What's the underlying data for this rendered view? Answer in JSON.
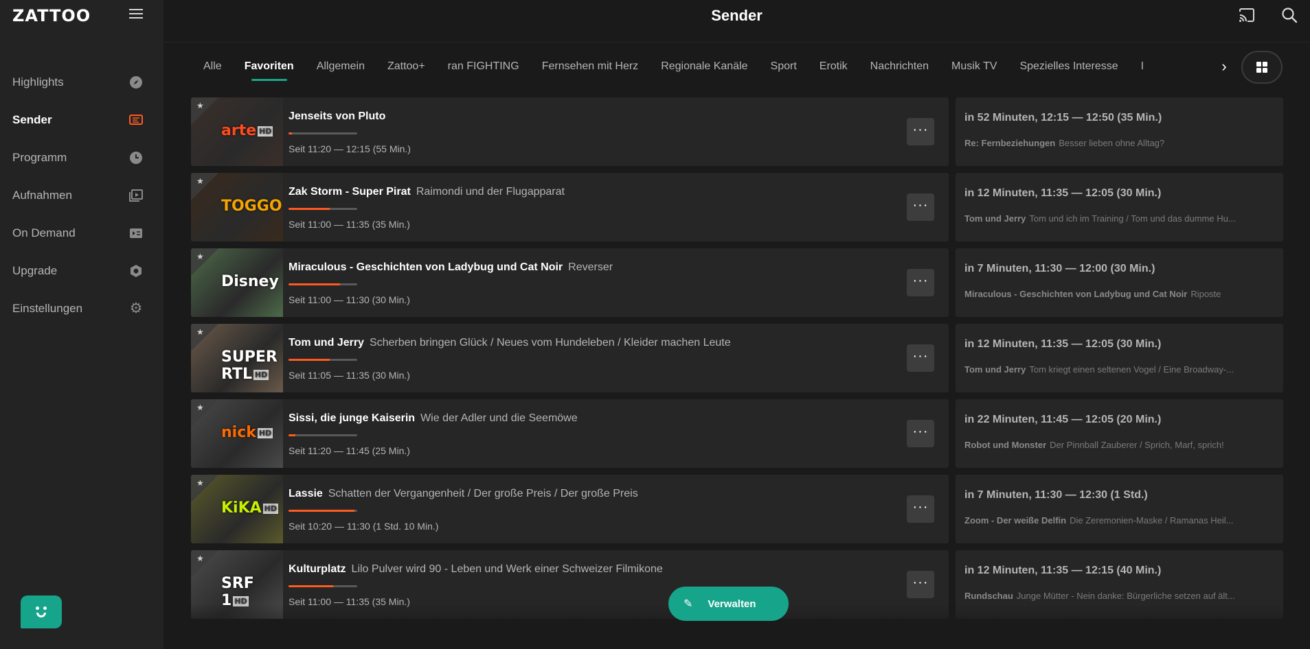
{
  "app": {
    "logo": "ZATTOO"
  },
  "header": {
    "title": "Sender"
  },
  "sidebar": {
    "items": [
      {
        "label": "Highlights",
        "icon": "compass-icon"
      },
      {
        "label": "Sender",
        "icon": "tv-icon",
        "active": true
      },
      {
        "label": "Programm",
        "icon": "clock-icon"
      },
      {
        "label": "Aufnahmen",
        "icon": "recordings-icon"
      },
      {
        "label": "On Demand",
        "icon": "on-demand-icon"
      },
      {
        "label": "Upgrade",
        "icon": "upgrade-icon"
      },
      {
        "label": "Einstellungen",
        "icon": "gear-icon"
      }
    ]
  },
  "tabs": [
    "Alle",
    "Favoriten",
    "Allgemein",
    "Zattoo+",
    "ran FIGHTING",
    "Fernsehen mit Herz",
    "Regionale Kanäle",
    "Sport",
    "Erotik",
    "Nachrichten",
    "Musik TV",
    "Spezielles Interesse",
    "I"
  ],
  "active_tab": "Favoriten",
  "channels": [
    {
      "logo": "arte",
      "logo_hd": "HD",
      "logo_color": "#ff4b1f",
      "title": "Jenseits von Pluto",
      "episode": "",
      "time": "Seit 11:20 — 12:15 (55 Min.)",
      "progress": 0.05,
      "next_head": "in 52 Minuten, 12:15 — 12:50 (35 Min.)",
      "next_title": "Re: Fernbeziehungen",
      "next_episode": "Besser lieben ohne Alltag?",
      "thumb_color": "#3b2f29"
    },
    {
      "logo": "TOGGO",
      "logo_hd": "HD",
      "logo_color": "#f6a400",
      "title": "Zak Storm - Super Pirat",
      "episode": "Raimondi und der Flugapparat",
      "time": "Seit 11:00 — 11:35 (35 Min.)",
      "progress": 0.6,
      "next_head": "in 12 Minuten, 11:35 — 12:05 (30 Min.)",
      "next_title": "Tom und Jerry",
      "next_episode": "Tom und ich im Training / Tom und das dumme Hu...",
      "thumb_color": "#3a2a1c"
    },
    {
      "logo": "Disney",
      "logo_hd": "",
      "logo_color": "#ffffff",
      "title": "Miraculous - Geschichten von Ladybug und Cat Noir",
      "episode": "Reverser",
      "time": "Seit 11:00 — 11:30 (30 Min.)",
      "progress": 0.75,
      "next_head": "in 7 Minuten, 11:30 — 12:00 (30 Min.)",
      "next_title": "Miraculous - Geschichten von Ladybug und Cat Noir",
      "next_episode": "Riposte",
      "thumb_color": "#4d6b4a"
    },
    {
      "logo": "SUPER RTL",
      "logo_hd": "HD",
      "logo_color": "#ffffff",
      "title": "Tom und Jerry",
      "episode": "Scherben bringen Glück / Neues vom Hundeleben / Kleider machen Leute",
      "time": "Seit 11:05 — 11:35 (30 Min.)",
      "progress": 0.6,
      "next_head": "in 12 Minuten, 11:35 — 12:05 (30 Min.)",
      "next_title": "Tom und Jerry",
      "next_episode": "Tom kriegt einen seltenen Vogel / Eine Broadway-...",
      "thumb_color": "#6b5a4a"
    },
    {
      "logo": "nick",
      "logo_hd": "HD",
      "logo_color": "#ff6a00",
      "title": "Sissi, die junge Kaiserin",
      "episode": "Wie der Adler und die Seemöwe",
      "time": "Seit 11:20 — 11:45 (25 Min.)",
      "progress": 0.1,
      "next_head": "in 22 Minuten, 11:45 — 12:05 (20 Min.)",
      "next_title": "Robot und Monster",
      "next_episode": "Der Pinnball Zauberer / Sprich, Marf, sprich!",
      "thumb_color": "#4a4a4a"
    },
    {
      "logo": "KiKA",
      "logo_hd": "HD",
      "logo_color": "#c6f000",
      "title": "Lassie",
      "episode": "Schatten der Vergangenheit / Der große Preis / Der große Preis",
      "time": "Seit 10:20 — 11:30 (1 Std. 10 Min.)",
      "progress": 0.96,
      "next_head": "in 7 Minuten, 11:30 — 12:30 (1 Std.)",
      "next_title": "Zoom - Der weiße Delfin",
      "next_episode": "Die Zeremonien-Maske / Ramanas Heil...",
      "thumb_color": "#5b5a2a"
    },
    {
      "logo": "SRF 1",
      "logo_hd": "HD",
      "logo_color": "#ffffff",
      "title": "Kulturplatz",
      "episode": "Lilo Pulver wird 90 - Leben und Werk einer Schweizer Filmikone",
      "time": "Seit 11:00 — 11:35 (35 Min.)",
      "progress": 0.65,
      "next_head": "in 12 Minuten, 11:35 — 12:15 (40 Min.)",
      "next_title": "Rundschau",
      "next_episode": "Junge Mütter - Nein danke: Bürgerliche setzen auf ält...",
      "thumb_color": "#4c4c4c"
    }
  ],
  "actions": {
    "manage_label": "Verwalten",
    "more_label": "···",
    "next_label": "›"
  },
  "colors": {
    "accent": "#16a48a",
    "progress": "#ff5a1f",
    "background": "#1a1a1a",
    "sidebar": "#232323"
  }
}
